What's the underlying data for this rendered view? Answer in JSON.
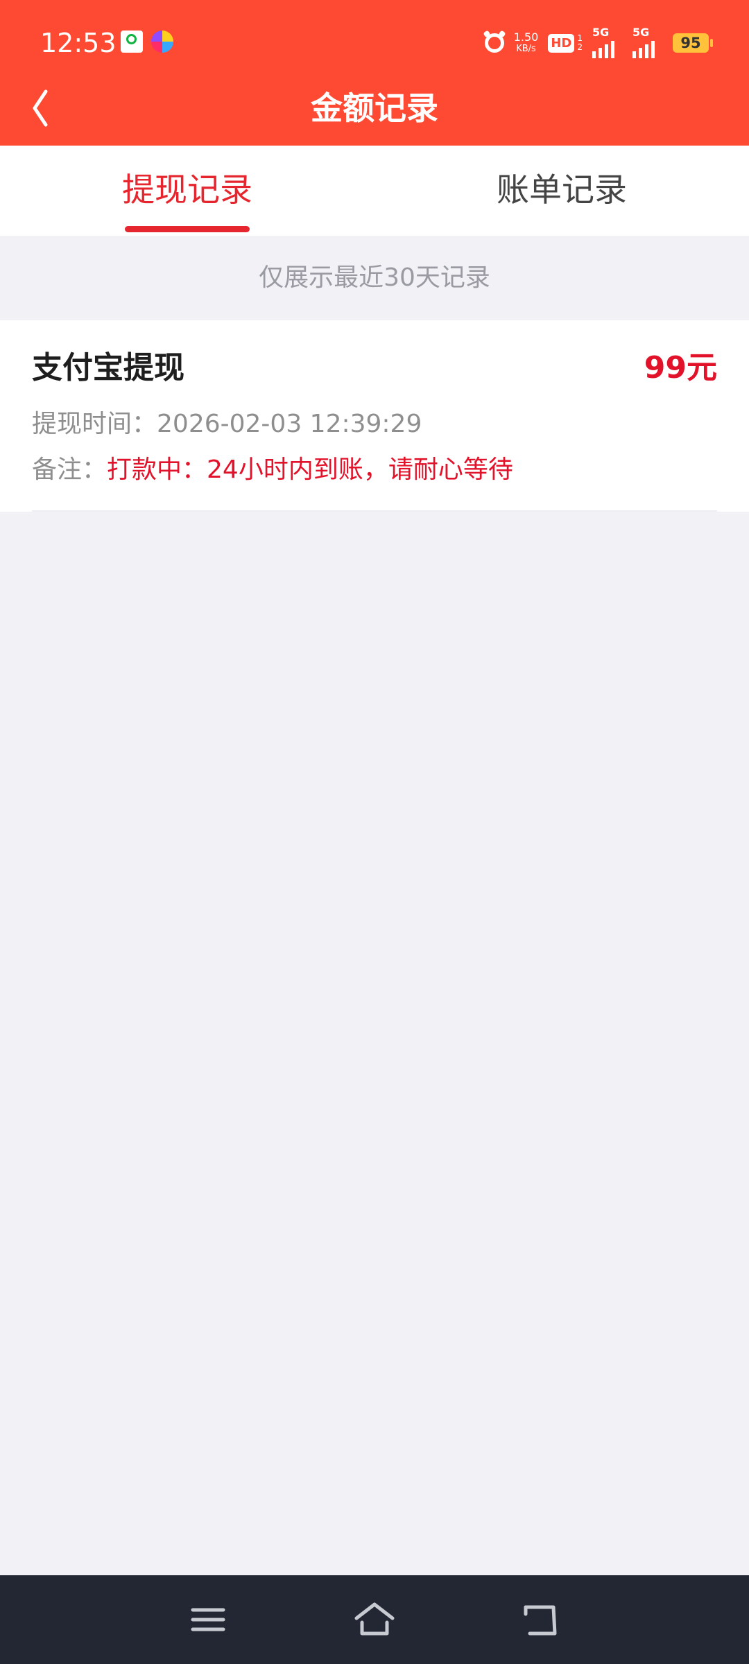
{
  "status_bar": {
    "time": "12:53",
    "app_icons": [
      "video-app-icon",
      "colorful-app-icon"
    ],
    "net_speed_value": "1.50",
    "net_speed_unit": "KB/s",
    "hd_label": "HD",
    "hd_sub_top": "1",
    "hd_sub_bottom": "2",
    "signal1_label": "5G",
    "signal2_label": "5G",
    "battery": "95"
  },
  "header": {
    "title": "金额记录",
    "back_icon": "chevron-left-icon"
  },
  "tabs": [
    {
      "label": "提现记录",
      "active": true
    },
    {
      "label": "账单记录",
      "active": false
    }
  ],
  "notice": "仅展示最近30天记录",
  "records": [
    {
      "title": "支付宝提现",
      "amount": "99元",
      "time_label": "提现时间：",
      "time_value": "2026-02-03 12:39:29",
      "note_label": "备注：",
      "note_value": "打款中：24小时内到账，请耐心等待"
    }
  ],
  "colors": {
    "header_bg": "#ff4a33",
    "accent_red": "#e5262e",
    "amount_red": "#e1122a",
    "page_bg": "#f1f1f6",
    "nav_bar_bg": "#232734"
  },
  "system_nav": {
    "icons": [
      "menu-icon",
      "home-icon",
      "back-icon"
    ]
  }
}
